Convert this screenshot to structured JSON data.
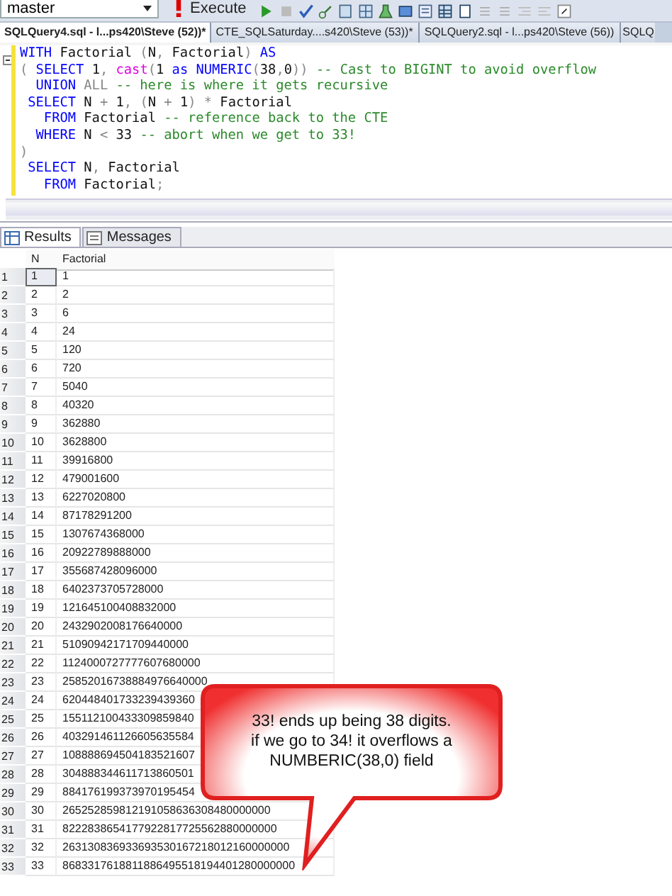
{
  "toolbar": {
    "database": "master",
    "execute_label": "Execute"
  },
  "document_tabs": [
    {
      "label": "SQLQuery4.sql - l...ps420\\Steve (52))*",
      "selected": true
    },
    {
      "label": "CTE_SQLSaturday....s420\\Steve (53))*",
      "selected": false
    },
    {
      "label": "SQLQuery2.sql - l...ps420\\Steve (56))",
      "selected": false
    },
    {
      "label": "SQLQ",
      "selected": false
    }
  ],
  "editor": {
    "lines": [
      [
        {
          "kind": "keyword",
          "text": "WITH"
        },
        {
          "kind": "plain",
          "text": " Factorial "
        },
        {
          "kind": "operator",
          "text": "("
        },
        {
          "kind": "plain",
          "text": "N"
        },
        {
          "kind": "operator",
          "text": ","
        },
        {
          "kind": "plain",
          "text": " Factorial"
        },
        {
          "kind": "operator",
          "text": ") "
        },
        {
          "kind": "keyword",
          "text": "AS"
        }
      ],
      [
        {
          "kind": "operator",
          "text": "( "
        },
        {
          "kind": "keyword",
          "text": "SELECT"
        },
        {
          "kind": "plain",
          "text": " 1"
        },
        {
          "kind": "operator",
          "text": ", "
        },
        {
          "kind": "function",
          "text": "cast"
        },
        {
          "kind": "operator",
          "text": "("
        },
        {
          "kind": "plain",
          "text": "1 "
        },
        {
          "kind": "keyword",
          "text": "as NUMERIC"
        },
        {
          "kind": "operator",
          "text": "("
        },
        {
          "kind": "plain",
          "text": "38"
        },
        {
          "kind": "operator",
          "text": ","
        },
        {
          "kind": "plain",
          "text": "0"
        },
        {
          "kind": "operator",
          "text": ")) "
        },
        {
          "kind": "comment",
          "text": "-- Cast to BIGINT to avoid overflow"
        }
      ],
      [
        {
          "kind": "keyword",
          "text": "  UNION "
        },
        {
          "kind": "operator",
          "text": "ALL "
        },
        {
          "kind": "comment",
          "text": "-- here is where it gets recursive"
        }
      ],
      [
        {
          "kind": "keyword",
          "text": " SELECT"
        },
        {
          "kind": "plain",
          "text": " N "
        },
        {
          "kind": "operator",
          "text": "+"
        },
        {
          "kind": "plain",
          "text": " 1"
        },
        {
          "kind": "operator",
          "text": ", ("
        },
        {
          "kind": "plain",
          "text": "N "
        },
        {
          "kind": "operator",
          "text": "+"
        },
        {
          "kind": "plain",
          "text": " 1"
        },
        {
          "kind": "operator",
          "text": ") *"
        },
        {
          "kind": "plain",
          "text": " Factorial"
        }
      ],
      [
        {
          "kind": "keyword",
          "text": "   FROM"
        },
        {
          "kind": "plain",
          "text": " Factorial "
        },
        {
          "kind": "comment",
          "text": "-- reference back to the CTE"
        }
      ],
      [
        {
          "kind": "keyword",
          "text": "  WHERE"
        },
        {
          "kind": "plain",
          "text": " N "
        },
        {
          "kind": "operator",
          "text": "<"
        },
        {
          "kind": "plain",
          "text": " 33 "
        },
        {
          "kind": "comment",
          "text": "-- abort when we get to 33!"
        }
      ],
      [
        {
          "kind": "operator",
          "text": ")"
        }
      ],
      [
        {
          "kind": "keyword",
          "text": " SELECT"
        },
        {
          "kind": "plain",
          "text": " N"
        },
        {
          "kind": "operator",
          "text": ","
        },
        {
          "kind": "plain",
          "text": " Factorial"
        }
      ],
      [
        {
          "kind": "keyword",
          "text": "   FROM"
        },
        {
          "kind": "plain",
          "text": " Factorial"
        },
        {
          "kind": "operator",
          "text": ";"
        }
      ]
    ]
  },
  "result_tabs": [
    {
      "label": "Results",
      "selected": true
    },
    {
      "label": "Messages",
      "selected": false
    }
  ],
  "grid": {
    "columns": [
      "N",
      "Factorial"
    ],
    "rows": [
      {
        "row": "1",
        "n": "1",
        "factorial": "1",
        "selected": true
      },
      {
        "row": "2",
        "n": "2",
        "factorial": "2",
        "selected": false
      },
      {
        "row": "3",
        "n": "3",
        "factorial": "6",
        "selected": false
      },
      {
        "row": "4",
        "n": "4",
        "factorial": "24",
        "selected": false
      },
      {
        "row": "5",
        "n": "5",
        "factorial": "120",
        "selected": false
      },
      {
        "row": "6",
        "n": "6",
        "factorial": "720",
        "selected": false
      },
      {
        "row": "7",
        "n": "7",
        "factorial": "5040",
        "selected": false
      },
      {
        "row": "8",
        "n": "8",
        "factorial": "40320",
        "selected": false
      },
      {
        "row": "9",
        "n": "9",
        "factorial": "362880",
        "selected": false
      },
      {
        "row": "10",
        "n": "10",
        "factorial": "3628800",
        "selected": false
      },
      {
        "row": "11",
        "n": "11",
        "factorial": "39916800",
        "selected": false
      },
      {
        "row": "12",
        "n": "12",
        "factorial": "479001600",
        "selected": false
      },
      {
        "row": "13",
        "n": "13",
        "factorial": "6227020800",
        "selected": false
      },
      {
        "row": "14",
        "n": "14",
        "factorial": "87178291200",
        "selected": false
      },
      {
        "row": "15",
        "n": "15",
        "factorial": "1307674368000",
        "selected": false
      },
      {
        "row": "16",
        "n": "16",
        "factorial": "20922789888000",
        "selected": false
      },
      {
        "row": "17",
        "n": "17",
        "factorial": "355687428096000",
        "selected": false
      },
      {
        "row": "18",
        "n": "18",
        "factorial": "6402373705728000",
        "selected": false
      },
      {
        "row": "19",
        "n": "19",
        "factorial": "121645100408832000",
        "selected": false
      },
      {
        "row": "20",
        "n": "20",
        "factorial": "2432902008176640000",
        "selected": false
      },
      {
        "row": "21",
        "n": "21",
        "factorial": "51090942171709440000",
        "selected": false
      },
      {
        "row": "22",
        "n": "22",
        "factorial": "1124000727777607680000",
        "selected": false
      },
      {
        "row": "23",
        "n": "23",
        "factorial": "25852016738884976640000",
        "selected": false
      },
      {
        "row": "24",
        "n": "24",
        "factorial": "620448401733239439360",
        "selected": false
      },
      {
        "row": "25",
        "n": "25",
        "factorial": "155112100433309859840",
        "selected": false
      },
      {
        "row": "26",
        "n": "26",
        "factorial": "403291461126605635584",
        "selected": false
      },
      {
        "row": "27",
        "n": "27",
        "factorial": "108888694504183521607",
        "selected": false
      },
      {
        "row": "28",
        "n": "28",
        "factorial": "304888344611713860501",
        "selected": false
      },
      {
        "row": "29",
        "n": "29",
        "factorial": "884176199373970195454",
        "selected": false
      },
      {
        "row": "30",
        "n": "30",
        "factorial": "265252859812191058636308480000000",
        "selected": false
      },
      {
        "row": "31",
        "n": "31",
        "factorial": "8222838654177922817725562880000000",
        "selected": false
      },
      {
        "row": "32",
        "n": "32",
        "factorial": "263130836933693530167218012160000000",
        "selected": false
      },
      {
        "row": "33",
        "n": "33",
        "factorial": "8683317618811886495518194401280000000",
        "selected": false
      }
    ]
  },
  "callout": {
    "lines": [
      "33! ends up being 38 digits.",
      "if we go to 34! it overflows a",
      "NUMBERIC(38,0) field"
    ]
  }
}
